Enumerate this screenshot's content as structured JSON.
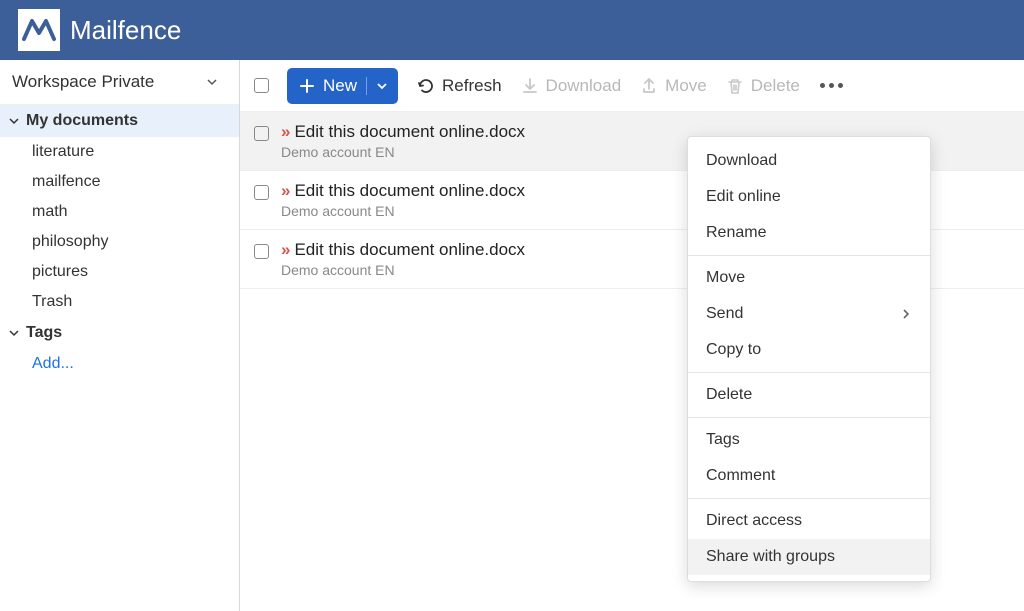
{
  "brand": {
    "name": "Mailfence"
  },
  "workspace": {
    "label": "Workspace Private"
  },
  "sidebar": {
    "root": {
      "label": "My documents"
    },
    "folders": [
      "literature",
      "mailfence",
      "math",
      "philosophy",
      "pictures",
      "Trash"
    ],
    "tags": {
      "label": "Tags",
      "add": "Add..."
    }
  },
  "toolbar": {
    "new": "New",
    "refresh": "Refresh",
    "download": "Download",
    "move": "Move",
    "delete": "Delete"
  },
  "files": [
    {
      "name": "Edit this document online.docx",
      "sub": "Demo account EN",
      "selected": true
    },
    {
      "name": "Edit this document online.docx",
      "sub": "Demo account EN",
      "selected": false
    },
    {
      "name": "Edit this document online.docx",
      "sub": "Demo account EN",
      "selected": false
    }
  ],
  "context_menu": {
    "groups": [
      [
        "Download",
        "Edit online",
        "Rename"
      ],
      [
        "Move",
        "Send",
        "Copy to"
      ],
      [
        "Delete"
      ],
      [
        "Tags",
        "Comment"
      ],
      [
        "Direct access",
        "Share with groups"
      ]
    ],
    "submenu": [
      "Send"
    ],
    "hovered": "Share with groups"
  }
}
